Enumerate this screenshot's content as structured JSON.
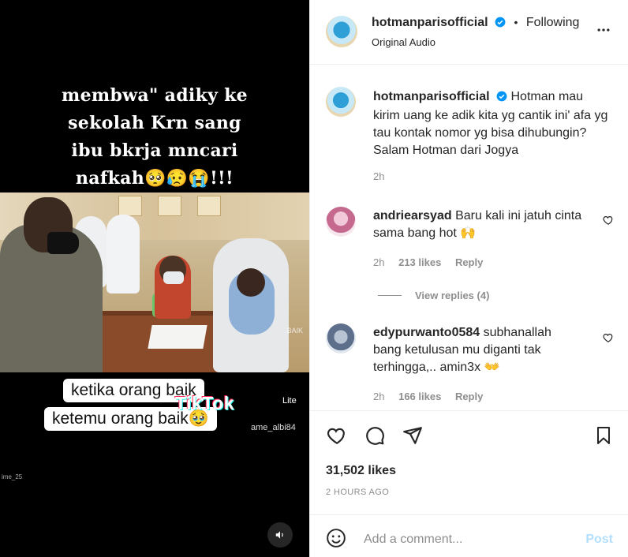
{
  "video": {
    "caption_top_lines": [
      "membwa\" adiky ke",
      "sekolah Krn sang",
      "ibu bkrja mncari",
      "nafkah🥺😥😭!!!"
    ],
    "overlay_line1": "ketika orang baik",
    "overlay_line2": "ketemu orang baik🥹",
    "tiktok_brand": "TikTok",
    "tiktok_lite": "Lite",
    "tiktok_user": "ame_albi84",
    "corner_user": "ime_25",
    "scene_watermark": "BAIK",
    "sound_icon": "speaker-icon"
  },
  "post": {
    "author": "hotmanparisofficial",
    "follow_label": "Following",
    "audio": "Original Audio",
    "separator": "•"
  },
  "caption": {
    "user": "hotmanparisofficial",
    "text": "Hotman mau kirim uang ke adik kita yg cantik ini' afa yg tau kontak nomor yg bisa dihubungin? Salam Hotman dari Jogya",
    "time": "2h"
  },
  "comments": [
    {
      "user": "andriearsyad",
      "text_line1": "Baru kali ini jatuh cinta",
      "text_line2": "sama bang hot 🙌",
      "time": "2h",
      "likes": "213 likes",
      "reply": "Reply",
      "view_replies": "View replies (4)"
    },
    {
      "user": "edypurwanto0584",
      "text_line1": "subhanallah",
      "text_line2": "bang ketulusan mu diganti tak",
      "text_line3": "terhingga,.. amin3x 👐",
      "time": "2h",
      "likes": "166 likes",
      "reply": "Reply"
    }
  ],
  "footer": {
    "likes": "31,502 likes",
    "ago": "2 HOURS AGO",
    "add_placeholder": "Add a comment...",
    "post_label": "Post"
  },
  "colors": {
    "verified_blue": "#0095f6",
    "muted": "#8e8e8e",
    "post_disabled": "#b2dffc"
  }
}
